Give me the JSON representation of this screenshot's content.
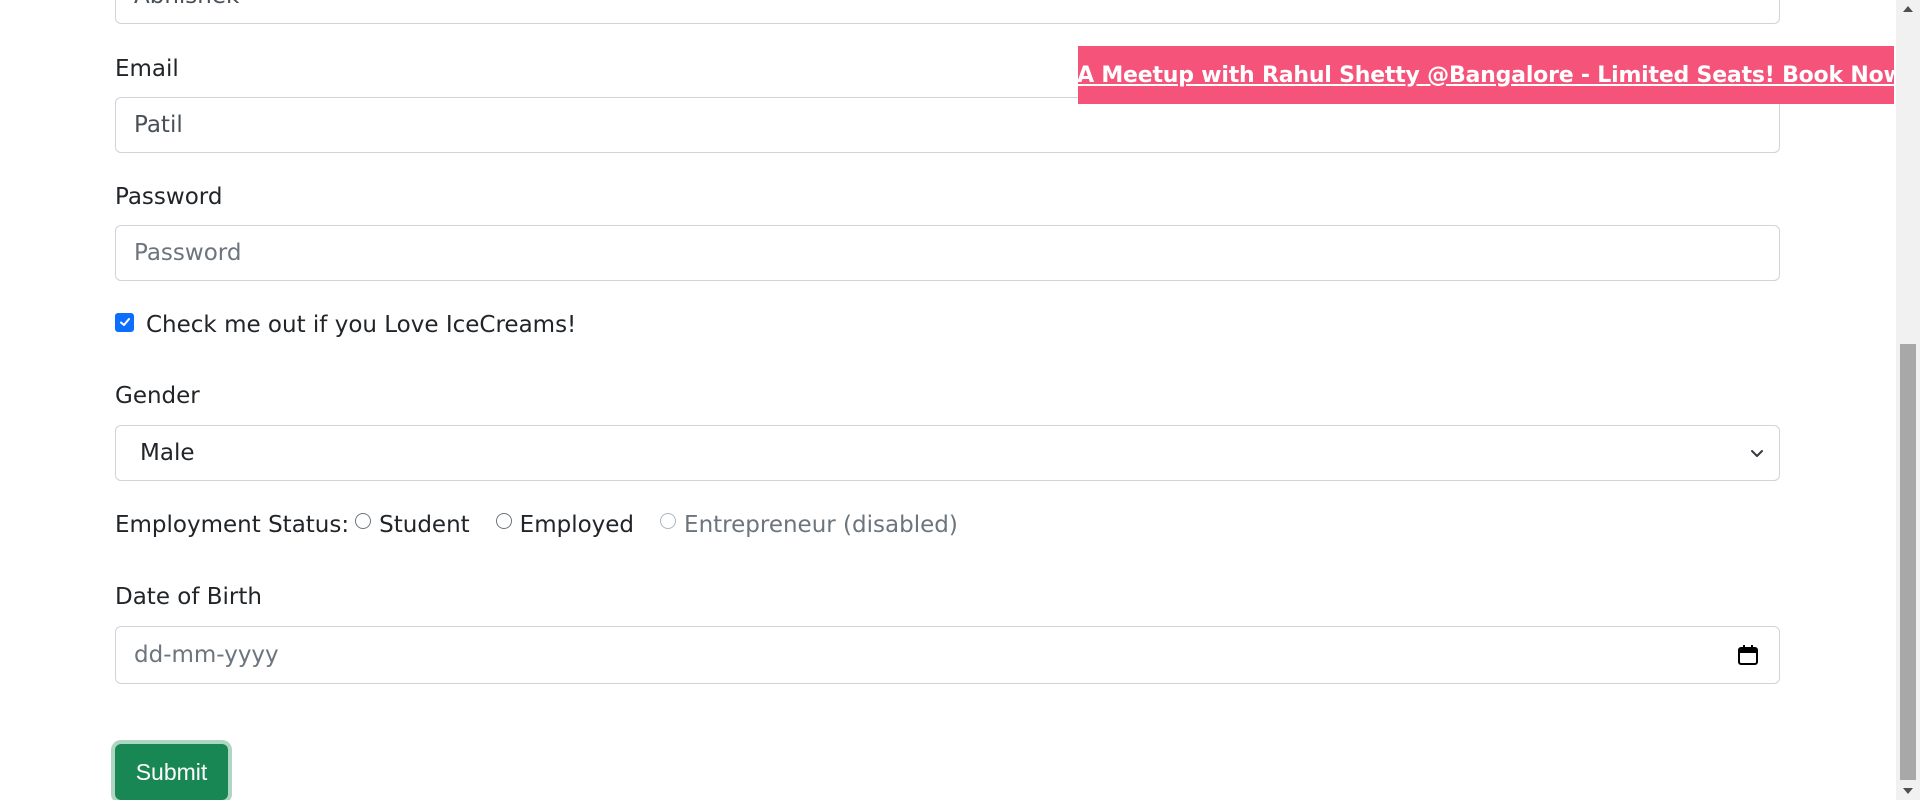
{
  "form": {
    "name_value": "Abhishek",
    "email_label": "Email",
    "email_value": "Patil",
    "password_label": "Password",
    "password_placeholder": "Password",
    "checkbox_label": "Check me out if you Love IceCreams!",
    "checkbox_checked": true,
    "gender_label": "Gender",
    "gender_selected": "Male",
    "employment_label": "Employment Status:",
    "employment_options": [
      {
        "label": "Student",
        "disabled": false
      },
      {
        "label": "Employed",
        "disabled": false
      },
      {
        "label": "Entrepreneur (disabled)",
        "disabled": true
      }
    ],
    "dob_label": "Date of Birth",
    "dob_placeholder": "dd-mm-yyyy",
    "submit_label": "Submit"
  },
  "banner": {
    "text": "QA Meetup with Rahul Shetty @Bangalore - Limited Seats! Book Now!"
  },
  "colors": {
    "banner_bg": "#f55379",
    "submit_bg": "#198754",
    "checkbox_accent": "#0d6efd"
  },
  "icons": {
    "select_arrow": "chevron-down-icon",
    "date_picker": "calendar-icon",
    "checkbox_mark": "check-icon"
  }
}
